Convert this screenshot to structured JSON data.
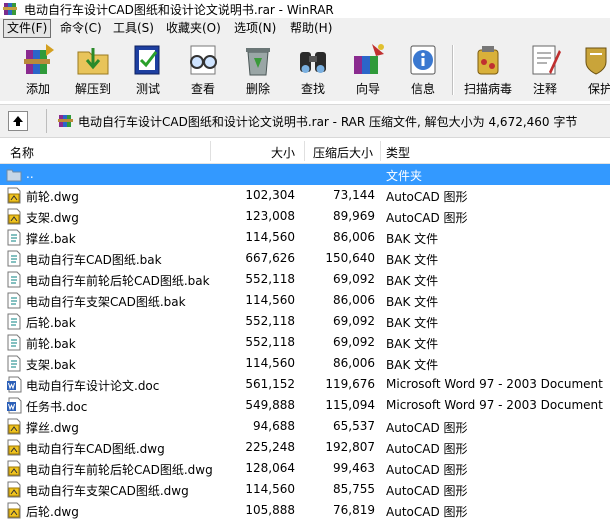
{
  "window": {
    "title": "电动自行车设计CAD图纸和设计论文说明书.rar - WinRAR"
  },
  "menu": [
    {
      "label": "文件(F)",
      "active": true
    },
    {
      "label": "命令(C)"
    },
    {
      "label": "工具(S)"
    },
    {
      "label": "收藏夹(O)"
    },
    {
      "label": "选项(N)"
    },
    {
      "label": "帮助(H)"
    }
  ],
  "toolbar": [
    {
      "id": "add",
      "label": "添加",
      "icon": "books-add-icon"
    },
    {
      "id": "extract",
      "label": "解压到",
      "icon": "folder-extract-icon"
    },
    {
      "id": "test",
      "label": "测试",
      "icon": "test-document-icon"
    },
    {
      "id": "view",
      "label": "查看",
      "icon": "glasses-view-icon"
    },
    {
      "id": "delete",
      "label": "删除",
      "icon": "recycle-bin-icon"
    },
    {
      "id": "find",
      "label": "查找",
      "icon": "binoculars-icon"
    },
    {
      "id": "wizard",
      "label": "向导",
      "icon": "wizard-icon"
    },
    {
      "id": "info",
      "label": "信息",
      "icon": "info-icon"
    },
    {
      "id": "virus",
      "label": "扫描病毒",
      "icon": "virus-scan-icon"
    },
    {
      "id": "comment",
      "label": "注释",
      "icon": "comment-icon"
    },
    {
      "id": "protect",
      "label": "保护",
      "icon": "protect-shield-icon"
    }
  ],
  "address": {
    "text": "电动自行车设计CAD图纸和设计论文说明书.rar - RAR 压缩文件, 解包大小为 4,672,460 字节"
  },
  "columns": {
    "name": "名称",
    "size": "大小",
    "packed": "压缩后大小",
    "type": "类型"
  },
  "files": [
    {
      "name": "..",
      "size": "",
      "packed": "",
      "type": "文件夹",
      "icon": "folder-up",
      "selected": true
    },
    {
      "name": "前轮.dwg",
      "size": "102,304",
      "packed": "73,144",
      "type": "AutoCAD 图形",
      "icon": "dwg"
    },
    {
      "name": "支架.dwg",
      "size": "123,008",
      "packed": "89,969",
      "type": "AutoCAD 图形",
      "icon": "dwg"
    },
    {
      "name": "撑丝.bak",
      "size": "114,560",
      "packed": "86,006",
      "type": "BAK 文件",
      "icon": "bak"
    },
    {
      "name": "电动自行车CAD图纸.bak",
      "size": "667,626",
      "packed": "150,640",
      "type": "BAK 文件",
      "icon": "bak"
    },
    {
      "name": "电动自行车前轮后轮CAD图纸.bak",
      "size": "552,118",
      "packed": "69,092",
      "type": "BAK 文件",
      "icon": "bak"
    },
    {
      "name": "电动自行车支架CAD图纸.bak",
      "size": "114,560",
      "packed": "86,006",
      "type": "BAK 文件",
      "icon": "bak"
    },
    {
      "name": "后轮.bak",
      "size": "552,118",
      "packed": "69,092",
      "type": "BAK 文件",
      "icon": "bak"
    },
    {
      "name": "前轮.bak",
      "size": "552,118",
      "packed": "69,092",
      "type": "BAK 文件",
      "icon": "bak"
    },
    {
      "name": "支架.bak",
      "size": "114,560",
      "packed": "86,006",
      "type": "BAK 文件",
      "icon": "bak"
    },
    {
      "name": "电动自行车设计论文.doc",
      "size": "561,152",
      "packed": "119,676",
      "type": "Microsoft Word 97 - 2003 Document",
      "icon": "doc"
    },
    {
      "name": "任务书.doc",
      "size": "549,888",
      "packed": "115,094",
      "type": "Microsoft Word 97 - 2003 Document",
      "icon": "doc"
    },
    {
      "name": "撑丝.dwg",
      "size": "94,688",
      "packed": "65,537",
      "type": "AutoCAD 图形",
      "icon": "dwg"
    },
    {
      "name": "电动自行车CAD图纸.dwg",
      "size": "225,248",
      "packed": "192,807",
      "type": "AutoCAD 图形",
      "icon": "dwg"
    },
    {
      "name": "电动自行车前轮后轮CAD图纸.dwg",
      "size": "128,064",
      "packed": "99,463",
      "type": "AutoCAD 图形",
      "icon": "dwg"
    },
    {
      "name": "电动自行车支架CAD图纸.dwg",
      "size": "114,560",
      "packed": "85,755",
      "type": "AutoCAD 图形",
      "icon": "dwg"
    },
    {
      "name": "后轮.dwg",
      "size": "105,888",
      "packed": "76,819",
      "type": "AutoCAD 图形",
      "icon": "dwg"
    }
  ],
  "colors": {
    "selection": "#3399ff",
    "chrome": "#f0f0f0"
  }
}
